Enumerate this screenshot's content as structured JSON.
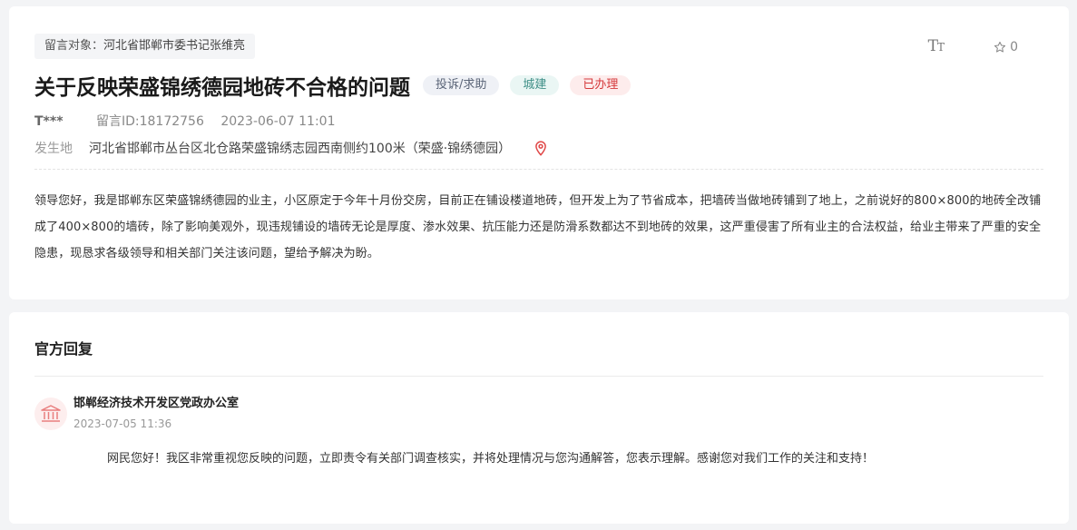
{
  "message": {
    "target_label": "留言对象：",
    "target_value": "河北省邯郸市委书记张维亮",
    "font_icon_text": "T",
    "font_icon_small": "T",
    "favorite_count": "0",
    "title": "关于反映荣盛锦绣德园地砖不合格的问题",
    "tags": {
      "type": "投诉/求助",
      "category": "城建",
      "status": "已办理"
    },
    "user": "T***",
    "message_id": "留言ID:18172756",
    "time": "2023-06-07 11:01",
    "location_label": "发生地",
    "location_value": "河北省邯郸市丛台区北仓路荣盛锦绣志园西南侧约100米（荣盛·锦绣德园）",
    "content": "领导您好，我是邯郸东区荣盛锦绣德园的业主，小区原定于今年十月份交房，目前正在铺设楼道地砖，但开发上为了节省成本，把墙砖当做地砖铺到了地上，之前说好的800×800的地砖全改铺成了400×800的墙砖，除了影响美观外，现违规铺设的墙砖无论是厚度、渗水效果、抗压能力还是防滑系数都达不到地砖的效果，这严重侵害了所有业主的合法权益，给业主带来了严重的安全隐患，现恳求各级领导和相关部门关注该问题，望给予解决为盼。"
  },
  "reply": {
    "heading": "官方回复",
    "org_name": "邯郸经济技术开发区党政办公室",
    "time": "2023-07-05 11:36",
    "body": "网民您好！我区非常重视您反映的问题，立即责令有关部门调查核实，并将处理情况与您沟通解答，您表示理解。感谢您对我们工作的关注和支持！"
  },
  "colors": {
    "status_red": "#d5393b",
    "location_pin": "#e04848",
    "org_avatar": "#e97e7e"
  }
}
